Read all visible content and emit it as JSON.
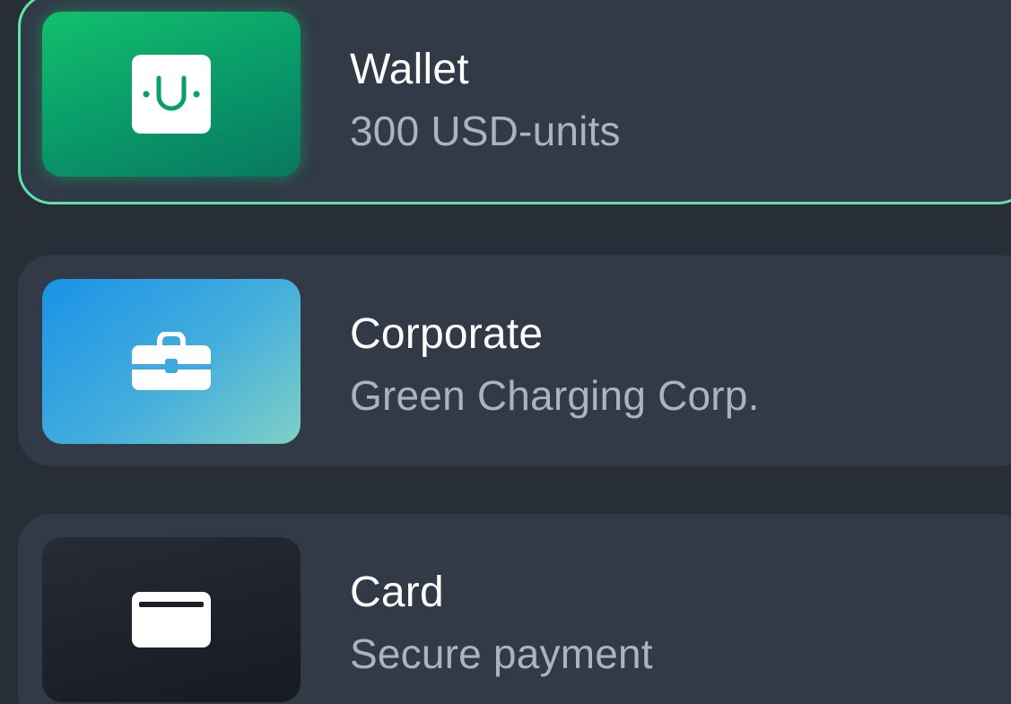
{
  "payment_options": [
    {
      "title": "Wallet",
      "subtitle": "300 USD-units",
      "icon": "wallet-icon",
      "selected": true,
      "accent_color": "#5fe3a1"
    },
    {
      "title": "Corporate",
      "subtitle": "Green Charging Corp.",
      "icon": "briefcase-icon",
      "selected": false
    },
    {
      "title": "Card",
      "subtitle": "Secure payment",
      "icon": "credit-card-icon",
      "selected": false
    }
  ],
  "colors": {
    "background": "#282e38",
    "option_background": "#313a46",
    "selected_border": "#5fe3a1",
    "title_text": "#ffffff",
    "subtitle_text": "#a9b4c2"
  }
}
